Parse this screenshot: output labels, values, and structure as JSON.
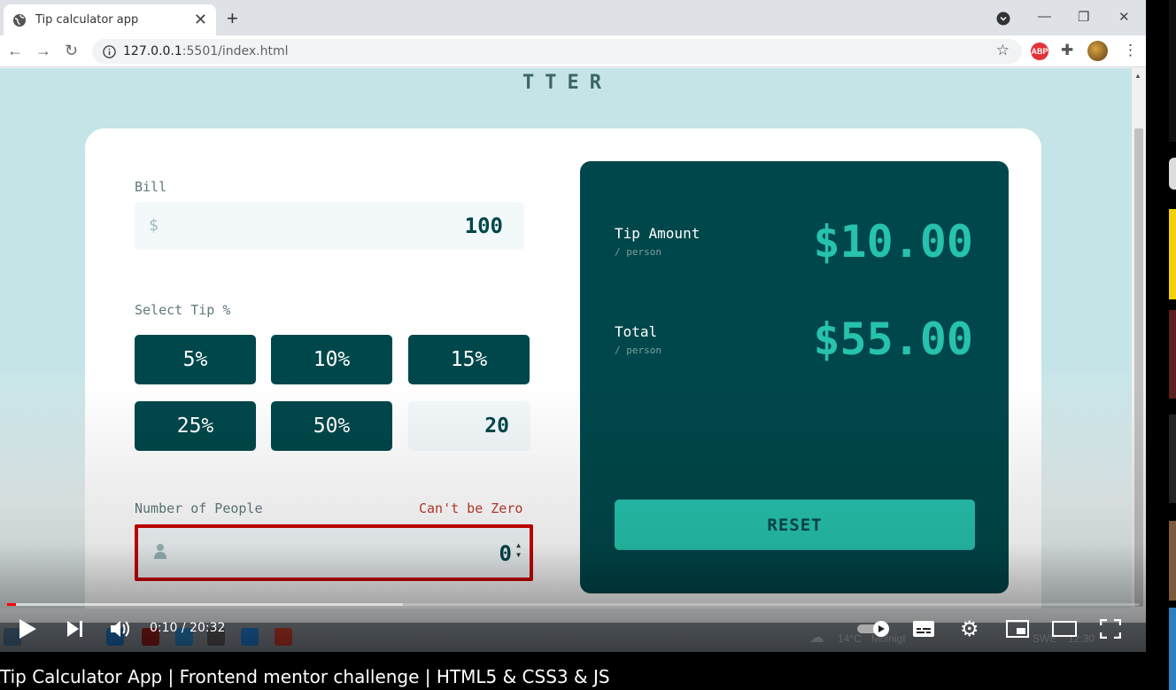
{
  "browser": {
    "tab_title": "Tip calculator app",
    "url_host": "127.0.0.1",
    "url_rest": ":5501/index.html"
  },
  "app": {
    "logo": "TTER",
    "bill": {
      "label": "Bill",
      "currency": "$",
      "value": "100"
    },
    "tip": {
      "label": "Select Tip %",
      "options": [
        "5%",
        "10%",
        "15%",
        "25%",
        "50%"
      ],
      "custom_value": "20"
    },
    "people": {
      "label": "Number of People",
      "error": "Can't be Zero",
      "value": "0"
    },
    "results": {
      "tip_label": "Tip Amount",
      "tip_sub": "/ person",
      "tip_value": "$10.00",
      "total_label": "Total",
      "total_sub": "/ person",
      "total_value": "$55.00",
      "reset_label": "RESET"
    }
  },
  "taskbar": {
    "weather": "14°C",
    "weather_desc": "Molnigt",
    "lang": "SWE",
    "clock": "12:30"
  },
  "player": {
    "time": "0:10 / 20:32",
    "played_fraction": 0.0081,
    "buffered_fraction": 0.35
  },
  "video_title": "Tip Calculator App | Frontend mentor challenge | HTML5 & CSS3 & JS",
  "colors": {
    "dark_cyan": "#00474b",
    "strong_cyan": "#26c2ad",
    "error_red": "#cc0000",
    "page_bg": "#c5e4e7"
  }
}
